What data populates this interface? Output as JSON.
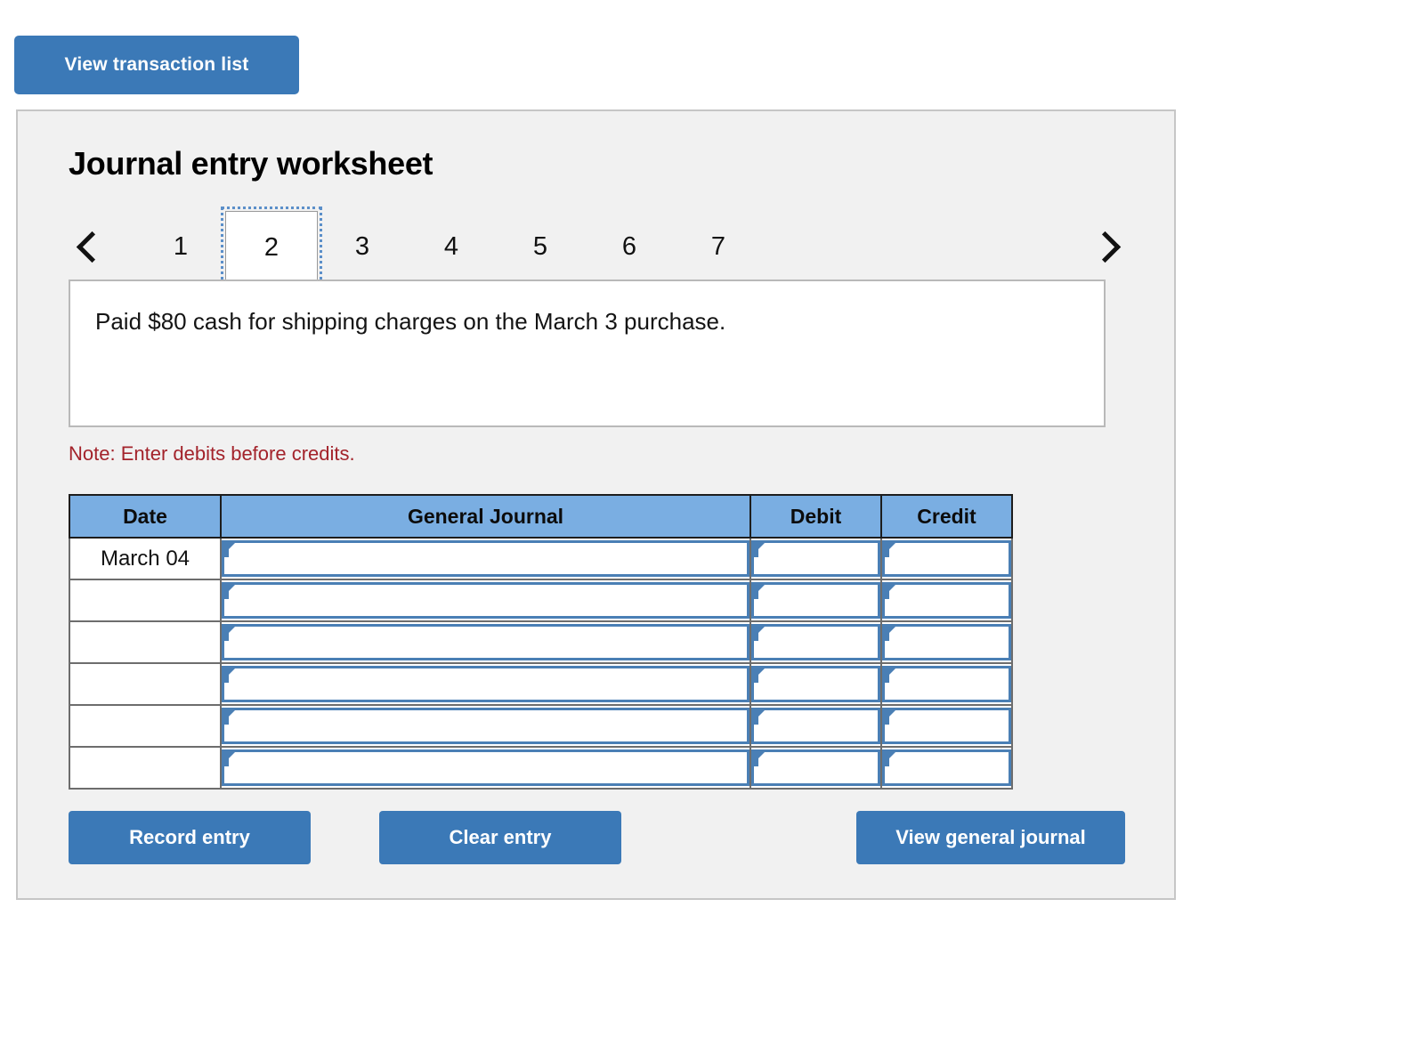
{
  "top": {
    "view_transaction_list_label": "View transaction list"
  },
  "worksheet": {
    "title": "Journal entry worksheet",
    "pager": {
      "prev_icon": "chevron-left-icon",
      "next_icon": "chevron-right-icon",
      "pages": [
        "1",
        "2",
        "3",
        "4",
        "5",
        "6",
        "7"
      ],
      "active_page": "2"
    },
    "description": "Paid $80 cash for shipping charges on the March 3 purchase.",
    "note": "Note: Enter debits before credits.",
    "table": {
      "headers": [
        "Date",
        "General Journal",
        "Debit",
        "Credit"
      ],
      "rows": [
        {
          "date": "March 04",
          "journal": "",
          "debit": "",
          "credit": ""
        },
        {
          "date": "",
          "journal": "",
          "debit": "",
          "credit": ""
        },
        {
          "date": "",
          "journal": "",
          "debit": "",
          "credit": ""
        },
        {
          "date": "",
          "journal": "",
          "debit": "",
          "credit": ""
        },
        {
          "date": "",
          "journal": "",
          "debit": "",
          "credit": ""
        },
        {
          "date": "",
          "journal": "",
          "debit": "",
          "credit": ""
        }
      ]
    },
    "buttons": {
      "record_entry": "Record entry",
      "clear_entry": "Clear entry",
      "view_general_journal": "View general journal"
    }
  },
  "colors": {
    "button_blue": "#3b79b7",
    "header_blue": "#7aaee2",
    "field_border_blue": "#4a7fb5",
    "note_red": "#a3232b",
    "panel_bg": "#f1f1f1",
    "panel_border": "#c6c6c6",
    "focus_outline": "#5b8fc9"
  }
}
